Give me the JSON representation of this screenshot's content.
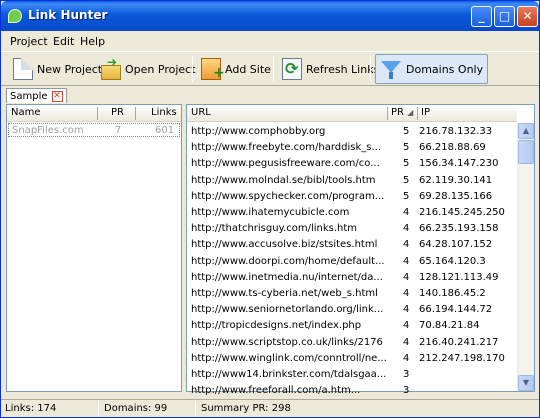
{
  "window": {
    "title": "Link Hunter",
    "minimize": "_",
    "maximize": "□",
    "close": "✕"
  },
  "menu": [
    "Project",
    "Edit",
    "Help"
  ],
  "toolbar": {
    "new_project": "New Project",
    "open_project": "Open Project",
    "add_site": "Add Site",
    "refresh_links": "Refresh Links",
    "domains_only": "Domains Only"
  },
  "tab": {
    "label": "Sample",
    "close": "✕"
  },
  "sites_table": {
    "columns": {
      "name": "Name",
      "pr": "PR",
      "links": "Links"
    },
    "rows": [
      {
        "name": "SnapFiles.com",
        "pr": "7",
        "links": "601"
      }
    ]
  },
  "links_table": {
    "columns": {
      "url": "URL",
      "pr": "PR",
      "ip": "IP"
    },
    "rows": [
      {
        "url": "http://www.comphobby.org",
        "pr": "5",
        "ip": "216.78.132.33"
      },
      {
        "url": "http://www.freebyte.com/harddisk_s...",
        "pr": "5",
        "ip": "66.218.88.69"
      },
      {
        "url": "http://www.pegusisfreeware.com/co...",
        "pr": "5",
        "ip": "156.34.147.230"
      },
      {
        "url": "http://www.molndal.se/bibl/tools.htm",
        "pr": "5",
        "ip": "62.119.30.141"
      },
      {
        "url": "http://www.spychecker.com/program...",
        "pr": "5",
        "ip": "69.28.135.166"
      },
      {
        "url": "http://www.ihatemycubicle.com",
        "pr": "4",
        "ip": "216.145.245.250"
      },
      {
        "url": "http://thatchrisguy.com/links.htm",
        "pr": "4",
        "ip": "66.235.193.158"
      },
      {
        "url": "http://www.accusolve.biz/stsites.html",
        "pr": "4",
        "ip": "64.28.107.152"
      },
      {
        "url": "http://www.doorpi.com/home/default...",
        "pr": "4",
        "ip": "65.164.120.3"
      },
      {
        "url": "http://www.inetmedia.nu/internet/da...",
        "pr": "4",
        "ip": "128.121.113.49"
      },
      {
        "url": "http://www.ts-cyberia.net/web_s.html",
        "pr": "4",
        "ip": "140.186.45.2"
      },
      {
        "url": "http://www.seniornetorlando.org/link...",
        "pr": "4",
        "ip": "66.194.144.72"
      },
      {
        "url": "http://tropicdesigns.net/index.php",
        "pr": "4",
        "ip": "70.84.21.84"
      },
      {
        "url": "http://www.scriptstop.co.uk/links/2176",
        "pr": "4",
        "ip": "216.40.241.217"
      },
      {
        "url": "http://www.winglink.com/conntroll/ne...",
        "pr": "4",
        "ip": "212.247.198.170"
      },
      {
        "url": "http://www14.brinkster.com/tdalsgaa...",
        "pr": "3",
        "ip": ""
      },
      {
        "url": "http://www.freeforall.com/a.htm...",
        "pr": "3",
        "ip": ""
      }
    ]
  },
  "status": {
    "links": "Links: 174",
    "domains": "Domains: 99",
    "summary_pr": "Summary PR: 298"
  }
}
